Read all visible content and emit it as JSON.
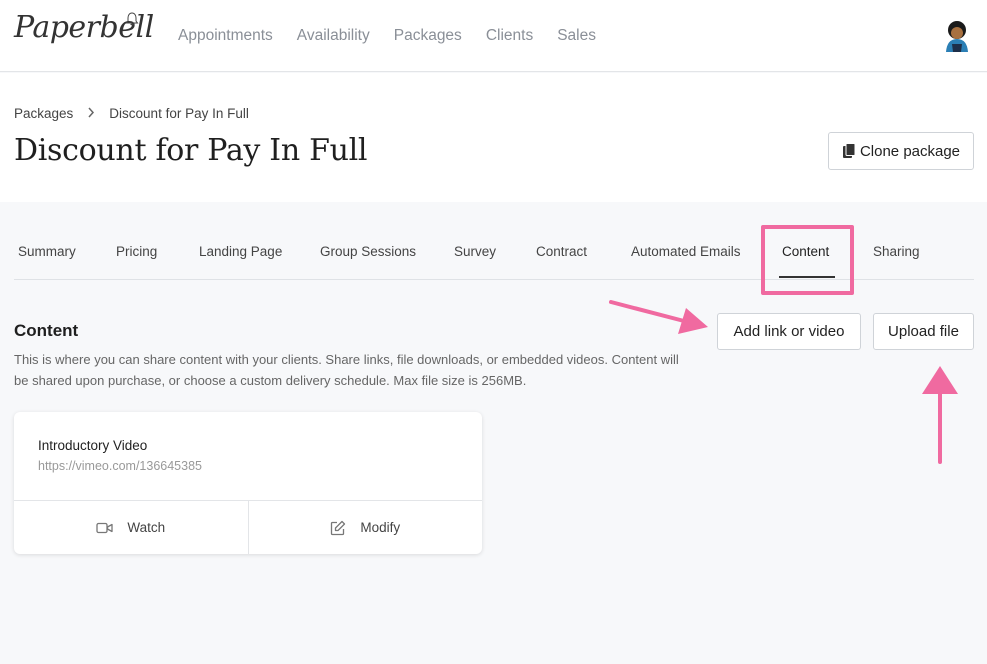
{
  "app": {
    "logo_text": "Paperbell"
  },
  "nav": {
    "items": [
      "Appointments",
      "Availability",
      "Packages",
      "Clients",
      "Sales"
    ]
  },
  "breadcrumb": {
    "parent": "Packages",
    "current": "Discount for Pay In Full"
  },
  "page": {
    "title": "Discount for Pay In Full",
    "clone_label": "Clone package"
  },
  "tabs": [
    "Summary",
    "Pricing",
    "Landing Page",
    "Group Sessions",
    "Survey",
    "Contract",
    "Automated Emails",
    "Content",
    "Sharing"
  ],
  "active_tab": "Content",
  "content": {
    "title": "Content",
    "description": "This is where you can share content with your clients. Share links, file downloads, or embedded videos. Content will be shared upon purchase, or choose a custom delivery schedule. Max file size is 256MB.",
    "add_label": "Add link or video",
    "upload_label": "Upload file"
  },
  "items": [
    {
      "title": "Introductory Video",
      "url": "https://vimeo.com/136645385",
      "watch_label": "Watch",
      "modify_label": "Modify"
    }
  ],
  "colors": {
    "highlight": "#f06aa0",
    "text": "#222222",
    "muted": "#8a8f97"
  }
}
